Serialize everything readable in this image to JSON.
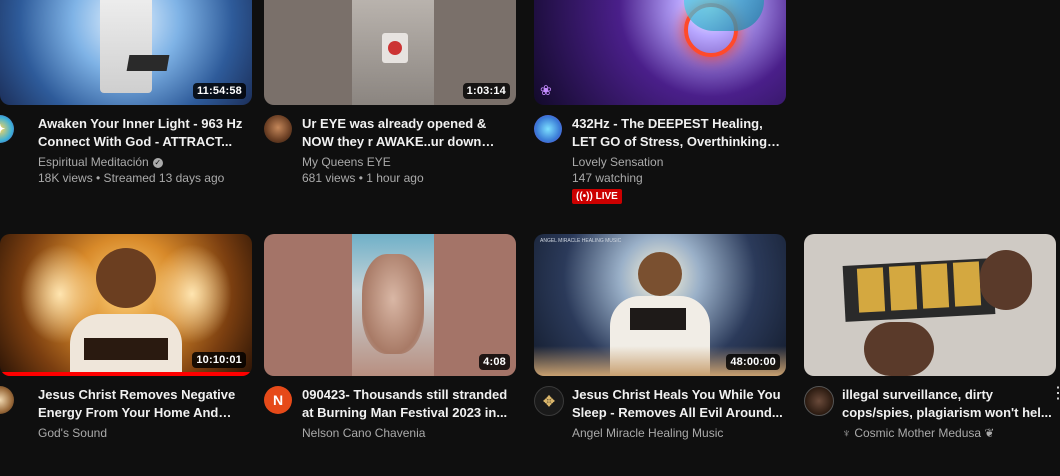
{
  "videos": [
    {
      "title": "Awaken Your Inner Light - 963 Hz Connect With God - ATTRACT...",
      "channel": "Espiritual Meditación",
      "stats": "18K views • Streamed 13 days ago",
      "duration": "11:54:58"
    },
    {
      "title": "Ur EYE was already opened & NOW they r AWAKE..ur down thei...",
      "channel": "My Queens EYE",
      "stats": "681 views • 1 hour ago",
      "duration": "1:03:14"
    },
    {
      "title": "432Hz - The DEEPEST Healing, LET GO of Stress, Overthinking &...",
      "channel": "Lovely Sensation",
      "stats": "147 watching",
      "live_badge": "LIVE"
    },
    {
      "title": "Jesus Christ Removes Negative Energy From Your Home And Min...",
      "channel": "God's Sound",
      "duration": "10:10:01",
      "progress": 1.0
    },
    {
      "title": "090423- Thousands still stranded at Burning Man Festival 2023 in...",
      "channel": "Nelson Cano Chavenia",
      "duration": "4:08",
      "avatar_letter": "N"
    },
    {
      "title": "Jesus Christ Heals You While You Sleep - Removes All Evil Around...",
      "channel": "Angel Miracle Healing Music",
      "duration": "48:00:00",
      "thumb_caption": "ANGEL MIRACLE HEALING MUSIC"
    },
    {
      "title": "illegal surveillance, dirty cops/spies, plagiarism won't hel...",
      "channel": "Cosmic Mother Medusa",
      "more_icon": "⋮"
    }
  ]
}
